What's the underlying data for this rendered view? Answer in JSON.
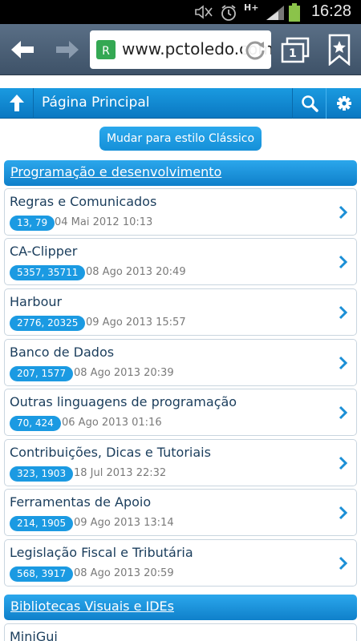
{
  "status_bar": {
    "time": "16:28",
    "network": "H+",
    "icons": [
      "mute-icon",
      "alarm-icon",
      "network-hplus-icon",
      "signal-icon",
      "battery-icon"
    ]
  },
  "browser": {
    "url": "www.pctoledo.com.br",
    "tab_count": "1",
    "icons": [
      "back-arrow-icon",
      "forward-arrow-icon",
      "favicon-icon",
      "reload-icon",
      "tabs-icon",
      "bookmark-icon"
    ]
  },
  "header": {
    "title": "Página Principal",
    "icons": [
      "home-arrow-icon",
      "search-icon",
      "gear-icon"
    ]
  },
  "style_switch": {
    "label": "Mudar para estilo Clássico"
  },
  "sections": [
    {
      "title": "Programação e desenvolvimento"
    },
    {
      "title": "Bibliotecas Visuais e IDEs"
    }
  ],
  "forums": [
    {
      "title": "Regras e Comunicados",
      "counts": "13, 79",
      "date": "04 Mai 2012 10:13"
    },
    {
      "title": "CA-Clipper",
      "counts": "5357, 35711",
      "date": "08 Ago 2013 20:49"
    },
    {
      "title": "Harbour",
      "counts": "2776, 20325",
      "date": "09 Ago 2013 15:57"
    },
    {
      "title": "Banco de Dados",
      "counts": "207, 1577",
      "date": "08 Ago 2013 20:39"
    },
    {
      "title": "Outras linguagens de programação",
      "counts": "70, 424",
      "date": "06 Ago 2013 01:16"
    },
    {
      "title": "Contribuições, Dicas e Tutoriais",
      "counts": "323, 1903",
      "date": "18 Jul 2013 22:32"
    },
    {
      "title": "Ferramentas de Apoio",
      "counts": "214, 1905",
      "date": "09 Ago 2013 13:14"
    },
    {
      "title": "Legislação Fiscal e Tributária",
      "counts": "568, 3917",
      "date": "08 Ago 2013 20:59"
    },
    {
      "title": "MiniGui",
      "counts": "",
      "date": ""
    }
  ],
  "colors": {
    "accent": "#1b9ae2",
    "header_blue": "#0a78c2",
    "item_title": "#1a3d5c"
  }
}
